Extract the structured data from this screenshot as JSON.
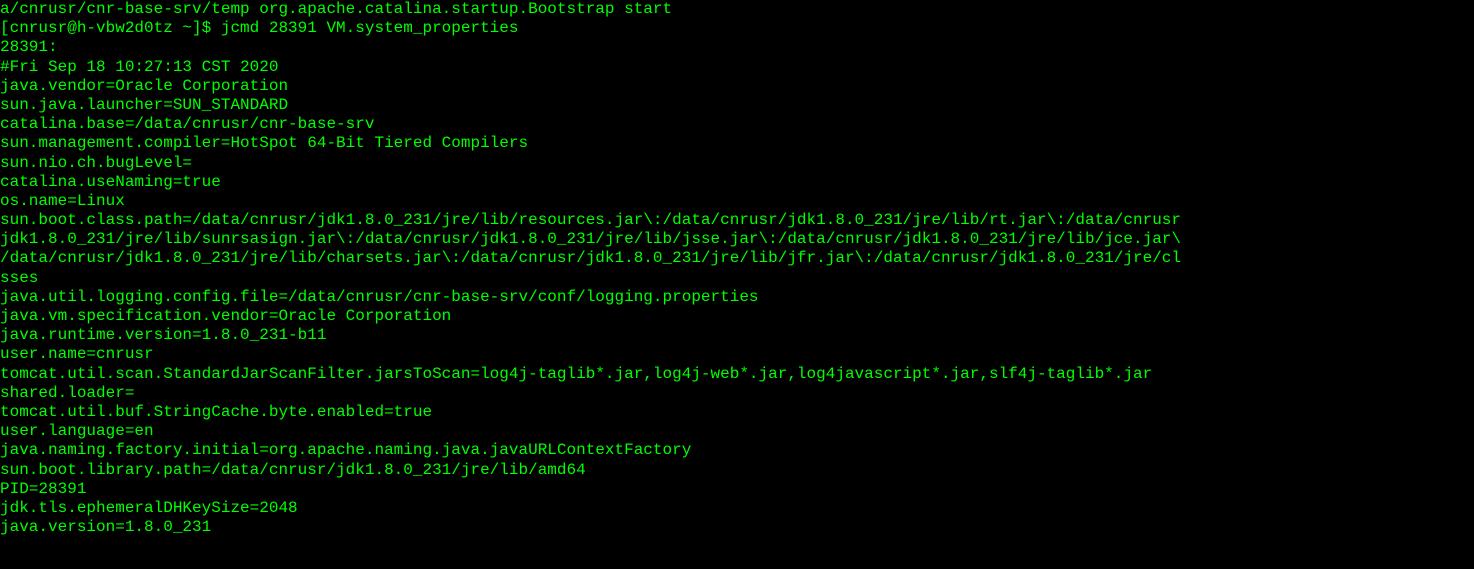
{
  "terminal": {
    "lines": [
      "a/cnrusr/cnr-base-srv/temp org.apache.catalina.startup.Bootstrap start",
      "[cnrusr@h-vbw2d0tz ~]$ jcmd 28391 VM.system_properties",
      "28391:",
      "#Fri Sep 18 10:27:13 CST 2020",
      "java.vendor=Oracle Corporation",
      "sun.java.launcher=SUN_STANDARD",
      "catalina.base=/data/cnrusr/cnr-base-srv",
      "sun.management.compiler=HotSpot 64-Bit Tiered Compilers",
      "sun.nio.ch.bugLevel=",
      "catalina.useNaming=true",
      "os.name=Linux",
      "sun.boot.class.path=/data/cnrusr/jdk1.8.0_231/jre/lib/resources.jar\\:/data/cnrusr/jdk1.8.0_231/jre/lib/rt.jar\\:/data/cnrusr",
      "jdk1.8.0_231/jre/lib/sunrsasign.jar\\:/data/cnrusr/jdk1.8.0_231/jre/lib/jsse.jar\\:/data/cnrusr/jdk1.8.0_231/jre/lib/jce.jar\\",
      "/data/cnrusr/jdk1.8.0_231/jre/lib/charsets.jar\\:/data/cnrusr/jdk1.8.0_231/jre/lib/jfr.jar\\:/data/cnrusr/jdk1.8.0_231/jre/cl",
      "sses",
      "java.util.logging.config.file=/data/cnrusr/cnr-base-srv/conf/logging.properties",
      "java.vm.specification.vendor=Oracle Corporation",
      "java.runtime.version=1.8.0_231-b11",
      "user.name=cnrusr",
      "tomcat.util.scan.StandardJarScanFilter.jarsToScan=log4j-taglib*.jar,log4j-web*.jar,log4javascript*.jar,slf4j-taglib*.jar",
      "shared.loader=",
      "tomcat.util.buf.StringCache.byte.enabled=true",
      "user.language=en",
      "java.naming.factory.initial=org.apache.naming.java.javaURLContextFactory",
      "sun.boot.library.path=/data/cnrusr/jdk1.8.0_231/jre/lib/amd64",
      "PID=28391",
      "jdk.tls.ephemeralDHKeySize=2048",
      "java.version=1.8.0_231"
    ]
  }
}
